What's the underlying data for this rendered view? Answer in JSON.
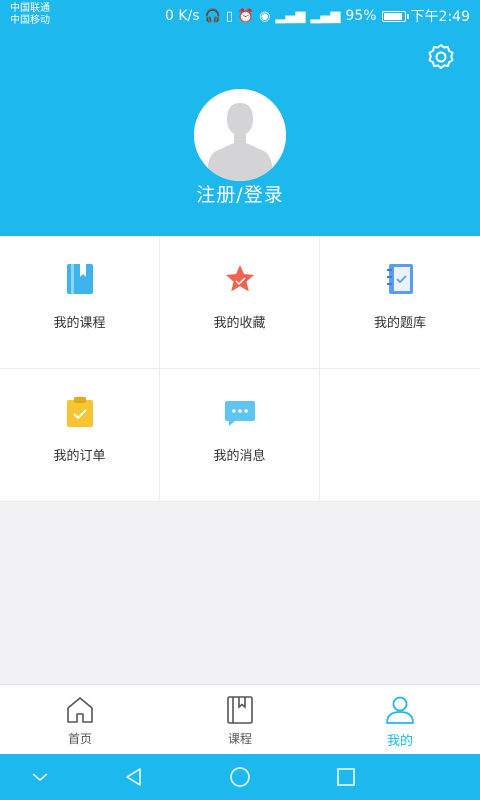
{
  "status_bar": {
    "carrier1": "中国联通",
    "carrier2": "中国移动",
    "speed": "0 K/s",
    "battery": "95%",
    "time": "下午2:49"
  },
  "header": {
    "login_label": "注册/登录"
  },
  "grid": {
    "items": [
      {
        "label": "我的课程",
        "icon": "book-icon"
      },
      {
        "label": "我的收藏",
        "icon": "star-icon"
      },
      {
        "label": "我的题库",
        "icon": "notebook-icon"
      },
      {
        "label": "我的订单",
        "icon": "clipboard-icon"
      },
      {
        "label": "我的消息",
        "icon": "message-icon"
      }
    ]
  },
  "bottom_nav": {
    "items": [
      {
        "label": "首页",
        "icon": "home-icon"
      },
      {
        "label": "课程",
        "icon": "course-book-icon"
      },
      {
        "label": "我的",
        "icon": "user-icon",
        "active": true
      }
    ]
  },
  "colors": {
    "primary": "#1cb8ee",
    "star": "#f06450",
    "clipboard": "#f7c531",
    "book": "#3fb3ea",
    "notebook": "#5a9cf0",
    "message": "#5cc5f2"
  }
}
